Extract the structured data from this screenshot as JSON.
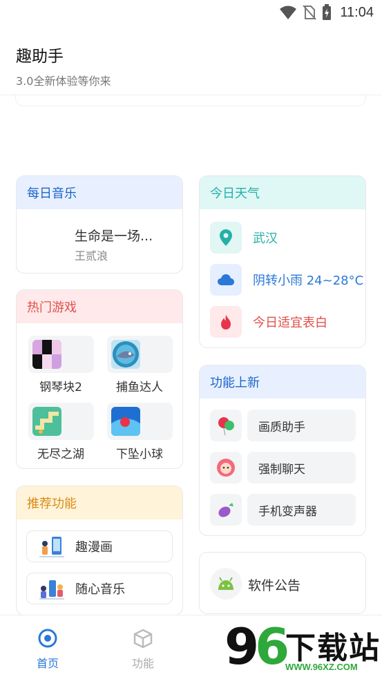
{
  "status_bar": {
    "time": "11:04",
    "icons": [
      "wifi-icon",
      "no-sim-icon",
      "battery-charging-icon"
    ]
  },
  "header": {
    "title": "趣助手",
    "subtitle": "3.0全新体验等你来"
  },
  "music": {
    "title": "每日音乐",
    "song": "生命是一场...",
    "artist": "王贰浪"
  },
  "games": {
    "title": "热门游戏",
    "items": [
      {
        "label": "钢琴块2",
        "icon": "piano-tiles-icon"
      },
      {
        "label": "捕鱼达人",
        "icon": "shark-icon"
      },
      {
        "label": "无尽之湖",
        "icon": "lake-path-icon"
      },
      {
        "label": "下坠小球",
        "icon": "falling-ball-icon"
      }
    ]
  },
  "recommend": {
    "title": "推荐功能",
    "items": [
      {
        "label": "趣漫画",
        "icon": "comic-illustration-icon"
      },
      {
        "label": "随心音乐",
        "icon": "music-illustration-icon"
      }
    ]
  },
  "weather": {
    "title": "今日天气",
    "city": "武汉",
    "condition": "阴转小雨 24~28°C",
    "advice": "今日适宜表白",
    "colors": {
      "city": "#25b0a6",
      "condition": "#2a78d8",
      "advice": "#e0504a"
    }
  },
  "features": {
    "title": "功能上新",
    "items": [
      {
        "label": "画质助手",
        "icon": "balloon-icon"
      },
      {
        "label": "强制聊天",
        "icon": "lion-face-icon"
      },
      {
        "label": "手机变声器",
        "icon": "eggplant-icon"
      }
    ]
  },
  "notice": {
    "label": "软件公告",
    "icon": "android-icon"
  },
  "tabs": [
    {
      "label": "首页",
      "icon": "home-target-icon",
      "active": true
    },
    {
      "label": "功能",
      "icon": "cube-icon",
      "active": false
    }
  ],
  "watermark": {
    "number": "96",
    "brand": "下载站",
    "url": "WWW.96XZ.COM"
  }
}
